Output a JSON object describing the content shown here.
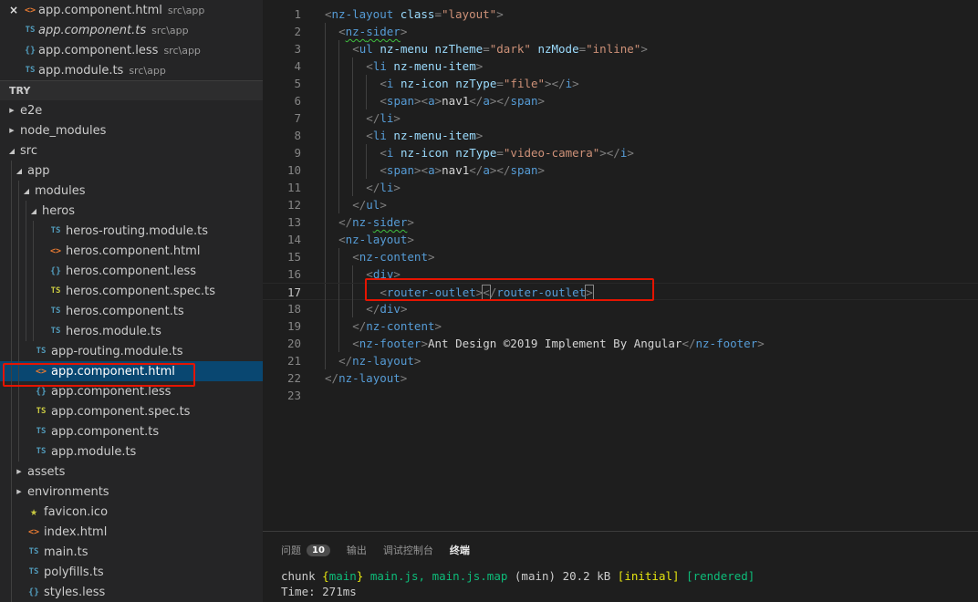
{
  "open_editors": [
    {
      "name": "app.component.html",
      "path": "src\\app",
      "icon": "html-icon",
      "active": true,
      "italic": false
    },
    {
      "name": "app.component.ts",
      "path": "src\\app",
      "icon": "ts-icon",
      "active": false,
      "italic": true
    },
    {
      "name": "app.component.less",
      "path": "src\\app",
      "icon": "less-icon",
      "active": false,
      "italic": false
    },
    {
      "name": "app.module.ts",
      "path": "src\\app",
      "icon": "ts-icon",
      "active": false,
      "italic": false
    }
  ],
  "icons": {
    "close": "×",
    "ts": "TS",
    "html": "<>",
    "less": "{}",
    "star": "★",
    "collapsed": "▶",
    "expanded": "◢"
  },
  "explorer": {
    "section_title": "TRY"
  },
  "tree": [
    {
      "name": "e2e",
      "depth": 0,
      "type": "folder",
      "expanded": false
    },
    {
      "name": "node_modules",
      "depth": 0,
      "type": "folder",
      "expanded": false
    },
    {
      "name": "src",
      "depth": 0,
      "type": "folder",
      "expanded": true
    },
    {
      "name": "app",
      "depth": 1,
      "type": "folder",
      "expanded": true
    },
    {
      "name": "modules",
      "depth": 2,
      "type": "folder",
      "expanded": true
    },
    {
      "name": "heros",
      "depth": 3,
      "type": "folder",
      "expanded": true
    },
    {
      "name": "heros-routing.module.ts",
      "depth": 4,
      "type": "ts"
    },
    {
      "name": "heros.component.html",
      "depth": 4,
      "type": "html"
    },
    {
      "name": "heros.component.less",
      "depth": 4,
      "type": "less"
    },
    {
      "name": "heros.component.spec.ts",
      "depth": 4,
      "type": "spec"
    },
    {
      "name": "heros.component.ts",
      "depth": 4,
      "type": "ts"
    },
    {
      "name": "heros.module.ts",
      "depth": 4,
      "type": "ts"
    },
    {
      "name": "app-routing.module.ts",
      "depth": 2,
      "type": "ts"
    },
    {
      "name": "app.component.html",
      "depth": 2,
      "type": "html",
      "selected": true
    },
    {
      "name": "app.component.less",
      "depth": 2,
      "type": "less"
    },
    {
      "name": "app.component.spec.ts",
      "depth": 2,
      "type": "spec"
    },
    {
      "name": "app.component.ts",
      "depth": 2,
      "type": "ts"
    },
    {
      "name": "app.module.ts",
      "depth": 2,
      "type": "ts"
    },
    {
      "name": "assets",
      "depth": 1,
      "type": "folder",
      "expanded": false
    },
    {
      "name": "environments",
      "depth": 1,
      "type": "folder",
      "expanded": false
    },
    {
      "name": "favicon.ico",
      "depth": 1,
      "type": "star"
    },
    {
      "name": "index.html",
      "depth": 1,
      "type": "html"
    },
    {
      "name": "main.ts",
      "depth": 1,
      "type": "ts"
    },
    {
      "name": "polyfills.ts",
      "depth": 1,
      "type": "ts"
    },
    {
      "name": "styles.less",
      "depth": 1,
      "type": "less"
    }
  ],
  "editor": {
    "current_line": 17,
    "lines": [
      {
        "n": "1",
        "indent": 0,
        "tokens": [
          [
            "p",
            "<"
          ],
          [
            "tag",
            "nz-layout"
          ],
          [
            "text",
            " "
          ],
          [
            "attr",
            "class"
          ],
          [
            "p",
            "="
          ],
          [
            "str",
            "\"layout\""
          ],
          [
            "p",
            ">"
          ]
        ]
      },
      {
        "n": "2",
        "indent": 1,
        "tokens": [
          [
            "p",
            "<"
          ],
          [
            "tag",
            "nz-",
            "squig"
          ],
          [
            "tag",
            "sider",
            "squig"
          ],
          [
            "p",
            ">"
          ]
        ]
      },
      {
        "n": "3",
        "indent": 2,
        "tokens": [
          [
            "p",
            "<"
          ],
          [
            "tag",
            "ul"
          ],
          [
            "text",
            " "
          ],
          [
            "attr",
            "nz-menu"
          ],
          [
            "text",
            " "
          ],
          [
            "attr",
            "nzTheme"
          ],
          [
            "p",
            "="
          ],
          [
            "str",
            "\"dark\""
          ],
          [
            "text",
            " "
          ],
          [
            "attr",
            "nzMode"
          ],
          [
            "p",
            "="
          ],
          [
            "str",
            "\"inline\""
          ],
          [
            "p",
            ">"
          ]
        ]
      },
      {
        "n": "4",
        "indent": 3,
        "tokens": [
          [
            "p",
            "<"
          ],
          [
            "tag",
            "li"
          ],
          [
            "text",
            " "
          ],
          [
            "attr",
            "nz-menu-item"
          ],
          [
            "p",
            ">"
          ]
        ]
      },
      {
        "n": "5",
        "indent": 4,
        "tokens": [
          [
            "p",
            "<"
          ],
          [
            "tag",
            "i"
          ],
          [
            "text",
            " "
          ],
          [
            "attr",
            "nz-icon"
          ],
          [
            "text",
            " "
          ],
          [
            "attr",
            "nzType"
          ],
          [
            "p",
            "="
          ],
          [
            "str",
            "\"file\""
          ],
          [
            "p",
            "></"
          ],
          [
            "tag",
            "i"
          ],
          [
            "p",
            ">"
          ]
        ]
      },
      {
        "n": "6",
        "indent": 4,
        "tokens": [
          [
            "p",
            "<"
          ],
          [
            "tag",
            "span"
          ],
          [
            "p",
            "><"
          ],
          [
            "tag",
            "a"
          ],
          [
            "p",
            ">"
          ],
          [
            "text",
            "nav1"
          ],
          [
            "p",
            "</"
          ],
          [
            "tag",
            "a"
          ],
          [
            "p",
            "></"
          ],
          [
            "tag",
            "span"
          ],
          [
            "p",
            ">"
          ]
        ]
      },
      {
        "n": "7",
        "indent": 3,
        "tokens": [
          [
            "p",
            "</"
          ],
          [
            "tag",
            "li"
          ],
          [
            "p",
            ">"
          ]
        ]
      },
      {
        "n": "8",
        "indent": 3,
        "tokens": [
          [
            "p",
            "<"
          ],
          [
            "tag",
            "li"
          ],
          [
            "text",
            " "
          ],
          [
            "attr",
            "nz-menu-item"
          ],
          [
            "p",
            ">"
          ]
        ]
      },
      {
        "n": "9",
        "indent": 4,
        "tokens": [
          [
            "p",
            "<"
          ],
          [
            "tag",
            "i"
          ],
          [
            "text",
            " "
          ],
          [
            "attr",
            "nz-icon"
          ],
          [
            "text",
            " "
          ],
          [
            "attr",
            "nzType"
          ],
          [
            "p",
            "="
          ],
          [
            "str",
            "\"video-camera\""
          ],
          [
            "p",
            "></"
          ],
          [
            "tag",
            "i"
          ],
          [
            "p",
            ">"
          ]
        ]
      },
      {
        "n": "10",
        "indent": 4,
        "tokens": [
          [
            "p",
            "<"
          ],
          [
            "tag",
            "span"
          ],
          [
            "p",
            "><"
          ],
          [
            "tag",
            "a"
          ],
          [
            "p",
            ">"
          ],
          [
            "text",
            "nav1"
          ],
          [
            "p",
            "</"
          ],
          [
            "tag",
            "a"
          ],
          [
            "p",
            "></"
          ],
          [
            "tag",
            "span"
          ],
          [
            "p",
            ">"
          ]
        ]
      },
      {
        "n": "11",
        "indent": 3,
        "tokens": [
          [
            "p",
            "</"
          ],
          [
            "tag",
            "li"
          ],
          [
            "p",
            ">"
          ]
        ]
      },
      {
        "n": "12",
        "indent": 2,
        "tokens": [
          [
            "p",
            "</"
          ],
          [
            "tag",
            "ul"
          ],
          [
            "p",
            ">"
          ]
        ]
      },
      {
        "n": "13",
        "indent": 1,
        "tokens": [
          [
            "p",
            "</"
          ],
          [
            "tag",
            "nz-"
          ],
          [
            "tag",
            "sider",
            "squig"
          ],
          [
            "p",
            ">"
          ]
        ]
      },
      {
        "n": "14",
        "indent": 1,
        "tokens": [
          [
            "p",
            "<"
          ],
          [
            "tag",
            "nz-layout"
          ],
          [
            "p",
            ">"
          ]
        ]
      },
      {
        "n": "15",
        "indent": 2,
        "tokens": [
          [
            "p",
            "<"
          ],
          [
            "tag",
            "nz-content"
          ],
          [
            "p",
            ">"
          ]
        ]
      },
      {
        "n": "16",
        "indent": 3,
        "tokens": [
          [
            "p",
            "<"
          ],
          [
            "tag",
            "div"
          ],
          [
            "p",
            ">"
          ]
        ]
      },
      {
        "n": "17",
        "indent": 4,
        "tokens": [
          [
            "p",
            "<"
          ],
          [
            "tag",
            "router-outlet"
          ],
          [
            "p",
            ">"
          ],
          [
            "p",
            "<",
            "cursor"
          ],
          [
            "p",
            "/"
          ],
          [
            "tag",
            "router-outlet"
          ],
          [
            "p",
            ">",
            "cursor"
          ]
        ]
      },
      {
        "n": "18",
        "indent": 3,
        "tokens": [
          [
            "p",
            "</"
          ],
          [
            "tag",
            "div"
          ],
          [
            "p",
            ">"
          ]
        ]
      },
      {
        "n": "19",
        "indent": 2,
        "tokens": [
          [
            "p",
            "</"
          ],
          [
            "tag",
            "nz-content"
          ],
          [
            "p",
            ">"
          ]
        ]
      },
      {
        "n": "20",
        "indent": 2,
        "tokens": [
          [
            "p",
            "<"
          ],
          [
            "tag",
            "nz-footer"
          ],
          [
            "p",
            ">"
          ],
          [
            "text",
            "Ant Design ©2019 Implement By Angular"
          ],
          [
            "p",
            "</"
          ],
          [
            "tag",
            "nz-footer"
          ],
          [
            "p",
            ">"
          ]
        ]
      },
      {
        "n": "21",
        "indent": 1,
        "tokens": [
          [
            "p",
            "</"
          ],
          [
            "tag",
            "nz-layout"
          ],
          [
            "p",
            ">"
          ]
        ]
      },
      {
        "n": "22",
        "indent": 0,
        "tokens": [
          [
            "p",
            "</"
          ],
          [
            "tag",
            "nz-layout"
          ],
          [
            "p",
            ">"
          ]
        ]
      },
      {
        "n": "23",
        "indent": 0,
        "tokens": []
      }
    ]
  },
  "panel": {
    "tabs": [
      {
        "label": "问题",
        "badge": "10",
        "active": false
      },
      {
        "label": "输出",
        "active": false
      },
      {
        "label": "调试控制台",
        "active": false
      },
      {
        "label": "终端",
        "active": true
      }
    ],
    "terminal_lines": [
      [
        [
          "w",
          "chunk "
        ],
        [
          "y",
          "{"
        ],
        [
          "g",
          "main"
        ],
        [
          "y",
          "}"
        ],
        [
          "w",
          " "
        ],
        [
          "g",
          "main.js, main.js.map"
        ],
        [
          "w",
          " (main) 20.2 kB "
        ],
        [
          "y",
          "[initial]"
        ],
        [
          "w",
          " "
        ],
        [
          "g",
          "[rendered]"
        ]
      ],
      [
        [
          "w",
          "Time: 271ms"
        ]
      ]
    ]
  }
}
